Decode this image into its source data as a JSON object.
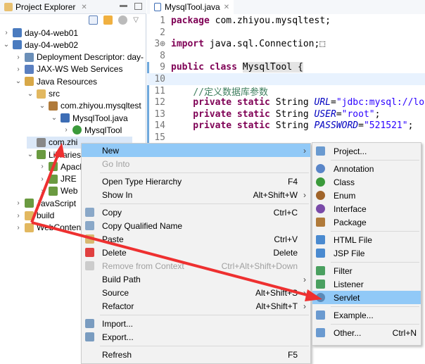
{
  "explorer": {
    "title": "Project Explorer",
    "tree": [
      {
        "label": "day-04-web01",
        "depth": 0,
        "chev": ">",
        "icon": "project-icon",
        "color": "#4a7bbf"
      },
      {
        "label": "day-04-web02",
        "depth": 0,
        "chev": "v",
        "icon": "project-icon",
        "color": "#4a7bbf"
      },
      {
        "label": "Deployment Descriptor: day-",
        "depth": 1,
        "chev": ">",
        "icon": "deployment-descriptor-icon",
        "color": "#6b8fb8"
      },
      {
        "label": "JAX-WS Web Services",
        "depth": 1,
        "chev": ">",
        "icon": "web-services-icon",
        "color": "#5a7fc0"
      },
      {
        "label": "Java Resources",
        "depth": 1,
        "chev": "v",
        "icon": "java-resources-icon",
        "color": "#d8a848"
      },
      {
        "label": "src",
        "depth": 2,
        "chev": "v",
        "icon": "source-folder-icon",
        "color": "#e2b860"
      },
      {
        "label": "com.zhiyou.mysqltest",
        "depth": 3,
        "chev": "v",
        "icon": "package-icon",
        "color": "#b07a3a"
      },
      {
        "label": "MysqlTool.java",
        "depth": 4,
        "chev": "v",
        "icon": "java-file-icon",
        "color": "#3d6db5"
      },
      {
        "label": "MysqlTool",
        "depth": 5,
        "chev": ">",
        "icon": "class-icon",
        "color": "#3b9a3b"
      },
      {
        "label": "com.zhi",
        "depth": 2,
        "chev": "",
        "icon": "package-icon",
        "color": "#888",
        "selected": true
      },
      {
        "label": "Libraries",
        "depth": 2,
        "chev": "v",
        "icon": "library-icon",
        "color": "#6a9a40"
      },
      {
        "label": "Apache",
        "depth": 3,
        "chev": ">",
        "icon": "library-icon",
        "color": "#6a9a40"
      },
      {
        "label": "JRE",
        "depth": 3,
        "chev": ">",
        "icon": "library-icon",
        "color": "#6a9a40"
      },
      {
        "label": "Web",
        "depth": 3,
        "chev": ">",
        "icon": "library-icon",
        "color": "#6a9a40"
      },
      {
        "label": "JavaScript",
        "depth": 1,
        "chev": ">",
        "icon": "library-icon",
        "color": "#6a9a40"
      },
      {
        "label": "build",
        "depth": 1,
        "chev": ">",
        "icon": "folder-icon",
        "color": "#e2b860"
      },
      {
        "label": "WebContent",
        "depth": 1,
        "chev": ">",
        "icon": "folder-icon",
        "color": "#e2b860"
      }
    ]
  },
  "editor": {
    "tab": "MysqlTool.java",
    "lines": [
      {
        "n": "1",
        "parts": [
          [
            "kw",
            "package"
          ],
          [
            "",
            "com.zhiyou.mysqltest;"
          ]
        ]
      },
      {
        "n": "2",
        "parts": []
      },
      {
        "n": "3⊕",
        "parts": [
          [
            "kw",
            "import"
          ],
          [
            "",
            "java.sql.Connection;⬚"
          ]
        ]
      },
      {
        "n": "8",
        "parts": []
      },
      {
        "n": "9",
        "parts": [
          [
            "kw",
            "public class"
          ],
          [
            "",
            "MysqlTool {"
          ]
        ]
      },
      {
        "n": "10",
        "parts": [],
        "hl": true
      },
      {
        "n": "11",
        "parts": [
          [
            "",
            "    "
          ],
          [
            "cm",
            "//定义数据库参数"
          ]
        ]
      },
      {
        "n": "12",
        "parts": [
          [
            "kw",
            "    private static"
          ],
          [
            "",
            "String "
          ],
          [
            "fld",
            "URL"
          ],
          [
            "",
            "="
          ],
          [
            "str",
            "\"jdbc:mysql://lo"
          ]
        ]
      },
      {
        "n": "13",
        "parts": [
          [
            "kw",
            "    private static"
          ],
          [
            "",
            "String "
          ],
          [
            "fld",
            "USER"
          ],
          [
            "",
            "="
          ],
          [
            "str",
            "\"root\""
          ],
          [
            "",
            ";"
          ]
        ]
      },
      {
        "n": "14",
        "parts": [
          [
            "kw",
            "    private static"
          ],
          [
            "",
            "String "
          ],
          [
            "fld",
            "PASSWORD"
          ],
          [
            "",
            "="
          ],
          [
            "str",
            "\"521521\""
          ],
          [
            "",
            ";"
          ]
        ]
      },
      {
        "n": "15",
        "parts": []
      }
    ]
  },
  "context_menu": [
    {
      "label": "New",
      "arrow": true,
      "active": true
    },
    {
      "label": "Go Into",
      "disabled": true
    },
    {
      "sep": true
    },
    {
      "label": "Open Type Hierarchy",
      "shortcut": "F4"
    },
    {
      "label": "Show In",
      "shortcut": "Alt+Shift+W",
      "arrow": true
    },
    {
      "sep": true
    },
    {
      "label": "Copy",
      "shortcut": "Ctrl+C",
      "icon": "copy-icon",
      "color": "#8aa8c8"
    },
    {
      "label": "Copy Qualified Name",
      "icon": "copy-qualified-name-icon",
      "color": "#8aa8c8"
    },
    {
      "label": "Paste",
      "shortcut": "Ctrl+V",
      "icon": "paste-icon",
      "color": "#d8b870"
    },
    {
      "label": "Delete",
      "shortcut": "Delete",
      "icon": "delete-icon",
      "color": "#e04040"
    },
    {
      "label": "Remove from Context",
      "shortcut": "Ctrl+Alt+Shift+Down",
      "disabled": true,
      "icon": "remove-context-icon",
      "color": "#ccc"
    },
    {
      "label": "Build Path",
      "arrow": true
    },
    {
      "label": "Source",
      "shortcut": "Alt+Shift+S",
      "arrow": true
    },
    {
      "label": "Refactor",
      "shortcut": "Alt+Shift+T",
      "arrow": true
    },
    {
      "sep": true
    },
    {
      "label": "Import...",
      "icon": "import-icon",
      "color": "#7a9cc0"
    },
    {
      "label": "Export...",
      "icon": "export-icon",
      "color": "#7a9cc0"
    },
    {
      "sep": true
    },
    {
      "label": "Refresh",
      "shortcut": "F5"
    }
  ],
  "new_submenu": [
    {
      "label": "Project...",
      "icon": "new-project-icon",
      "color": "#6a9ad0"
    },
    {
      "sep": true
    },
    {
      "label": "Annotation",
      "icon": "annotation-icon",
      "color": "#5a86c8"
    },
    {
      "label": "Class",
      "icon": "class-icon",
      "color": "#3b9a3b"
    },
    {
      "label": "Enum",
      "icon": "enum-icon",
      "color": "#a0642a"
    },
    {
      "label": "Interface",
      "icon": "interface-icon",
      "color": "#7a4aa8"
    },
    {
      "label": "Package",
      "icon": "package-icon",
      "color": "#b07a3a"
    },
    {
      "sep": true
    },
    {
      "label": "HTML File",
      "icon": "html-file-icon",
      "color": "#4a8ad0"
    },
    {
      "label": "JSP File",
      "icon": "jsp-file-icon",
      "color": "#4a8ad0"
    },
    {
      "sep": true
    },
    {
      "label": "Filter",
      "icon": "filter-icon",
      "color": "#4aa060"
    },
    {
      "label": "Listener",
      "icon": "listener-icon",
      "color": "#4aa060"
    },
    {
      "label": "Servlet",
      "icon": "servlet-icon",
      "color": "#5a8ab8",
      "active": true
    },
    {
      "sep": true
    },
    {
      "label": "Example...",
      "icon": "example-icon",
      "color": "#6a9ad0"
    },
    {
      "sep": true
    },
    {
      "label": "Other...",
      "shortcut": "Ctrl+N",
      "icon": "other-wizard-icon",
      "color": "#6a9ad0"
    }
  ],
  "annotation_color": "#ee3030"
}
